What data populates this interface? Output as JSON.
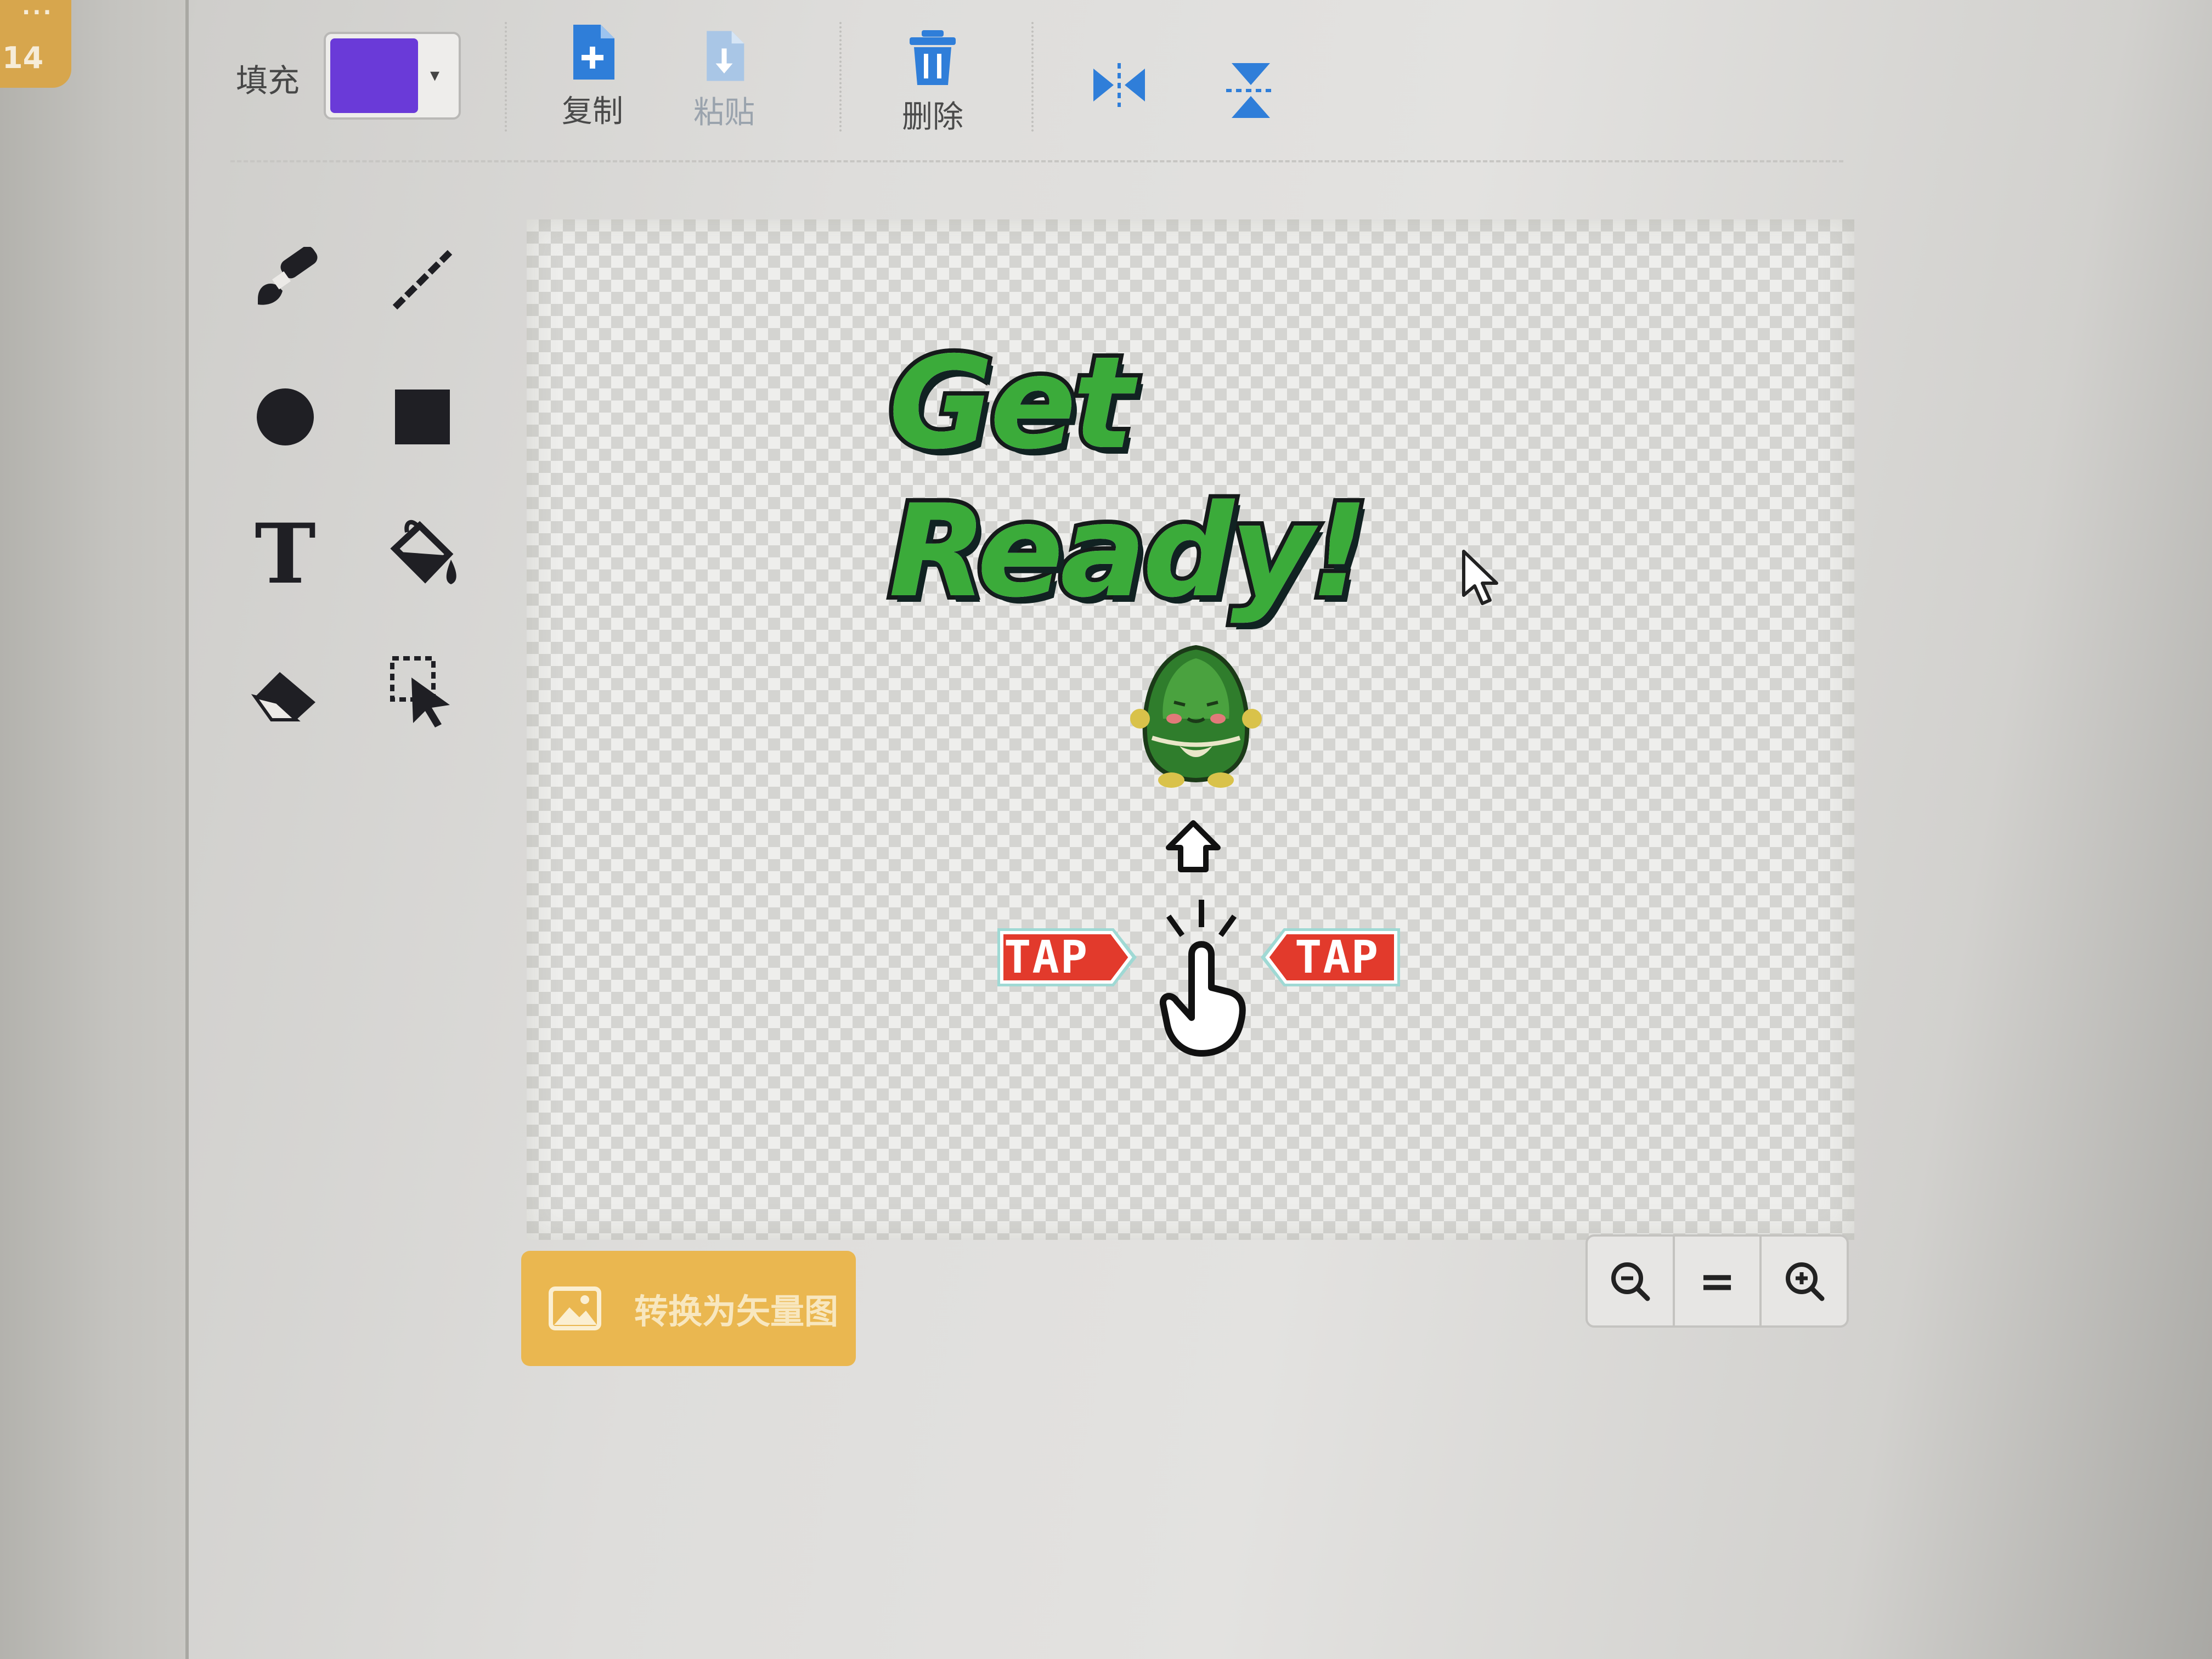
{
  "costume_badge": {
    "number": "14",
    "dots": "···"
  },
  "toolbar": {
    "fill_label": "填充",
    "fill_color": "#6a3ad8",
    "copy_label": "复制",
    "paste_label": "粘贴",
    "delete_label": "删除",
    "flip_horizontal_icon": "flip-horizontal-icon",
    "flip_vertical_icon": "flip-vertical-icon"
  },
  "tools": [
    {
      "name": "brush",
      "icon": "brush-icon"
    },
    {
      "name": "line",
      "icon": "line-icon"
    },
    {
      "name": "circle",
      "icon": "circle-icon"
    },
    {
      "name": "rectangle",
      "icon": "rectangle-icon"
    },
    {
      "name": "text",
      "icon": "text-icon",
      "glyph": "T"
    },
    {
      "name": "fill",
      "icon": "paint-bucket-icon"
    },
    {
      "name": "eraser",
      "icon": "eraser-icon"
    },
    {
      "name": "select",
      "icon": "select-icon"
    }
  ],
  "canvas": {
    "title_text": "Get Ready!",
    "tap_left": "TAP",
    "tap_right": "TAP",
    "title_color": "#3bab3a"
  },
  "convert_button": {
    "label": "转换为矢量图"
  },
  "zoom": {
    "out_icon": "zoom-out-icon",
    "reset_label": "=",
    "in_icon": "zoom-in-icon"
  }
}
